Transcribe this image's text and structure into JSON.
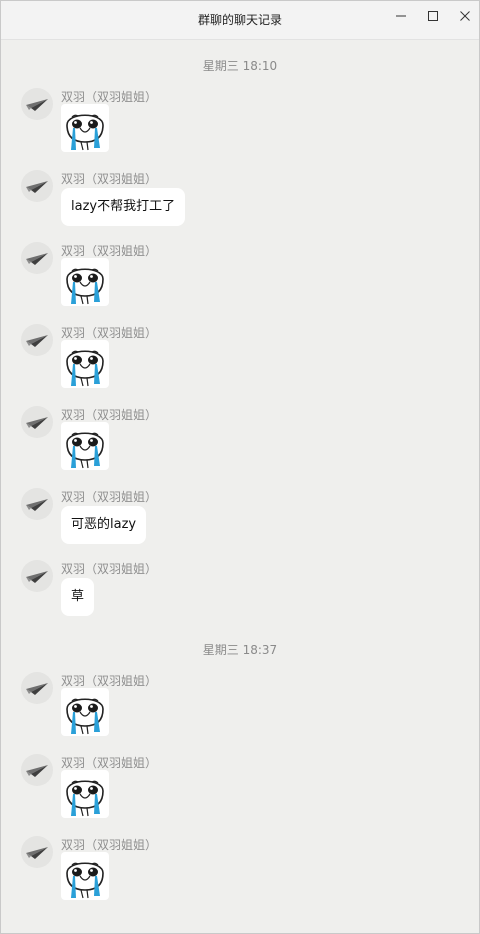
{
  "window": {
    "title": "群聊的聊天记录"
  },
  "icons": {
    "minimize": "minimize-icon",
    "maximize": "maximize-icon",
    "close": "close-icon",
    "avatar": "paper-plane-avatar",
    "sticker": "crying-face-sticker"
  },
  "colors": {
    "background": "#efefed",
    "bubble": "#ffffff",
    "timestamp": "#8a8a8a",
    "sender": "#8f8f8f",
    "tear": "#2aa0d8"
  },
  "timestamps": [
    "星期三 18:10",
    "星期三 18:37"
  ],
  "messages": [
    {
      "sender": "双羽（双羽姐姐）",
      "type": "sticker"
    },
    {
      "sender": "双羽（双羽姐姐）",
      "type": "text",
      "text": "lazy不帮我打工了"
    },
    {
      "sender": "双羽（双羽姐姐）",
      "type": "sticker"
    },
    {
      "sender": "双羽（双羽姐姐）",
      "type": "sticker"
    },
    {
      "sender": "双羽（双羽姐姐）",
      "type": "sticker"
    },
    {
      "sender": "双羽（双羽姐姐）",
      "type": "text",
      "text": "可恶的lazy"
    },
    {
      "sender": "双羽（双羽姐姐）",
      "type": "text",
      "text": "草"
    },
    {
      "sender": "双羽（双羽姐姐）",
      "type": "sticker"
    },
    {
      "sender": "双羽（双羽姐姐）",
      "type": "sticker"
    },
    {
      "sender": "双羽（双羽姐姐）",
      "type": "sticker"
    }
  ]
}
